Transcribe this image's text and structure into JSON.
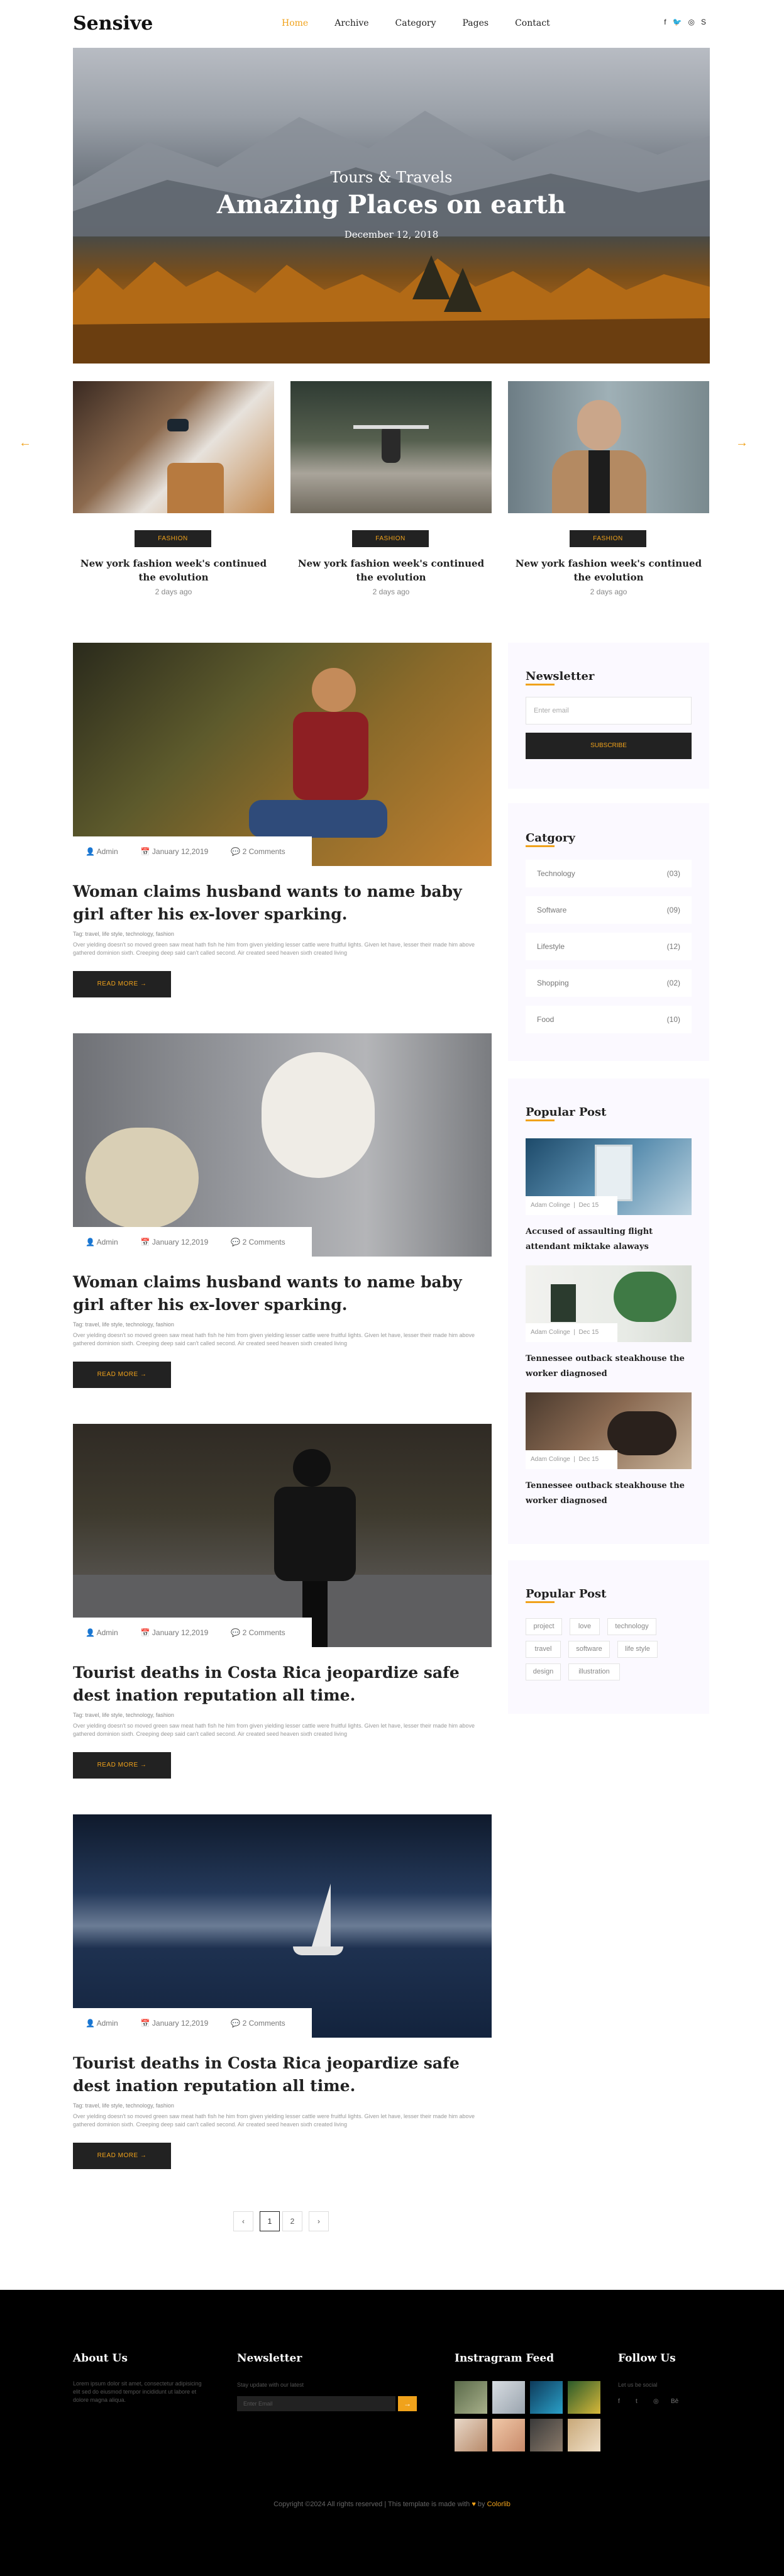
{
  "header": {
    "logo": "Sensive",
    "nav": [
      {
        "label": "Home",
        "active": true
      },
      {
        "label": "Archive"
      },
      {
        "label": "Category"
      },
      {
        "label": "Pages"
      },
      {
        "label": "Contact"
      }
    ],
    "social_icons": [
      "facebook-icon",
      "twitter-icon",
      "instagram-icon",
      "skype-icon"
    ],
    "social_glyphs": [
      "f",
      "🐦",
      "◎",
      "S"
    ]
  },
  "hero": {
    "kicker": "Tours & Travels",
    "title": "Amazing Places on earth",
    "date": "December 12, 2018"
  },
  "carousel": {
    "prev": "←",
    "next": "→",
    "cards": [
      {
        "tag": "FASHION",
        "title": "New york fashion week's continued the evolution",
        "ago": "2 days ago"
      },
      {
        "tag": "FASHION",
        "title": "New york fashion week's continued the evolution",
        "ago": "2 days ago"
      },
      {
        "tag": "FASHION",
        "title": "New york fashion week's continued the evolution",
        "ago": "2 days ago"
      }
    ]
  },
  "posts": [
    {
      "author": "Admin",
      "date": "January 12,2019",
      "comments": "2 Comments",
      "title": "Woman claims husband wants to name baby girl after his ex-lover sparking.",
      "tags": "Tag: travel, life style, technology, fashion",
      "excerpt": "Over yielding doesn't so moved green saw meat hath fish he him from given yielding lesser cattle were fruitful lights. Given let have, lesser their made him above gathered dominion sixth. Creeping deep said can't called second. Air created seed heaven sixth created living",
      "readmore": "READ MORE"
    },
    {
      "author": "Admin",
      "date": "January 12,2019",
      "comments": "2 Comments",
      "title": "Woman claims husband wants to name baby girl after his ex-lover sparking.",
      "tags": "Tag: travel, life style, technology, fashion",
      "excerpt": "Over yielding doesn't so moved green saw meat hath fish he him from given yielding lesser cattle were fruitful lights. Given let have, lesser their made him above gathered dominion sixth. Creeping deep said can't called second. Air created seed heaven sixth created living",
      "readmore": "READ MORE"
    },
    {
      "author": "Admin",
      "date": "January 12,2019",
      "comments": "2 Comments",
      "title": "Tourist deaths in Costa Rica jeopardize safe dest ination reputation all time.",
      "tags": "Tag: travel, life style, technology, fashion",
      "excerpt": "Over yielding doesn't so moved green saw meat hath fish he him from given yielding lesser cattle were fruitful lights. Given let have, lesser their made him above gathered dominion sixth. Creeping deep said can't called second. Air created seed heaven sixth created living",
      "readmore": "READ MORE"
    },
    {
      "author": "Admin",
      "date": "January 12,2019",
      "comments": "2 Comments",
      "title": "Tourist deaths in Costa Rica jeopardize safe dest ination reputation all time.",
      "tags": "Tag: travel, life style, technology, fashion",
      "excerpt": "Over yielding doesn't so moved green saw meat hath fish he him from given yielding lesser cattle were fruitful lights. Given let have, lesser their made him above gathered dominion sixth. Creeping deep said can't called second. Air created seed heaven sixth created living",
      "readmore": "READ MORE"
    }
  ],
  "pagination": {
    "prev": "‹",
    "pages": [
      "1",
      "2"
    ],
    "next": "›",
    "current": "1"
  },
  "sidebar": {
    "newsletter": {
      "heading": "Newsletter",
      "placeholder": "Enter email",
      "button": "SUBSCRIBE"
    },
    "category": {
      "heading": "Catgory",
      "items": [
        {
          "name": "Technology",
          "count": "(03)"
        },
        {
          "name": "Software",
          "count": "(09)"
        },
        {
          "name": "Lifestyle",
          "count": "(12)"
        },
        {
          "name": "Shopping",
          "count": "(02)"
        },
        {
          "name": "Food",
          "count": "(10)"
        }
      ]
    },
    "popular": {
      "heading": "Popular Post",
      "items": [
        {
          "author": "Adam Colinge",
          "date": "Dec 15",
          "title": "Accused of assaulting flight attendant miktake alaways"
        },
        {
          "author": "Adam Colinge",
          "date": "Dec 15",
          "title": "Tennessee outback steakhouse the worker diagnosed"
        },
        {
          "author": "Adam Colinge",
          "date": "Dec 15",
          "title": "Tennessee outback steakhouse the worker diagnosed"
        }
      ]
    },
    "tags": {
      "heading": "Popular Post",
      "items": [
        "project",
        "love",
        "technology",
        "travel",
        "software",
        "life style",
        "design",
        "illustration"
      ]
    }
  },
  "footer": {
    "about": {
      "heading": "About Us",
      "text": "Lorem ipsum dolor sit amet, consectetur adipisicing elit sed do eiusmod tempor incididunt ut labore et dolore magna aliqua."
    },
    "newsletter": {
      "heading": "Newsletter",
      "text": "Stay update with our latest",
      "placeholder": "Enter Email",
      "button": "→"
    },
    "instagram": {
      "heading": "Instragram Feed"
    },
    "follow": {
      "heading": "Follow Us",
      "text": "Let us be social",
      "icons": [
        "facebook-icon",
        "twitter-icon",
        "dribbble-icon",
        "behance-icon"
      ],
      "glyphs": [
        "f",
        "t",
        "◎",
        "Bē"
      ]
    },
    "copyright_prefix": "Copyright ©2024 All rights reserved | This template is made with",
    "heart": "♥",
    "by": "by",
    "brand": "Colorlib"
  },
  "colors": {
    "accent": "#f0a21b",
    "dark": "#222222",
    "sidebar_bg": "#fbf9ff",
    "footer_bg": "#000000"
  }
}
